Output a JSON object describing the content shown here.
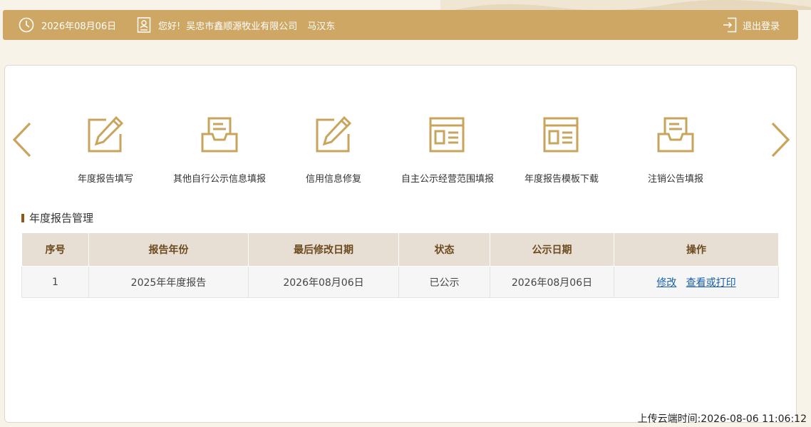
{
  "header": {
    "date": "2026年08月06日",
    "greeting": "您好!",
    "company": "吴忠市鑫顺源牧业有限公司",
    "user": "马汉东",
    "logout_label": "退出登录"
  },
  "functions": [
    {
      "label": "年度报告填写",
      "icon": "pencil-edit-icon"
    },
    {
      "label": "其他自行公示信息填报",
      "icon": "inbox-document-icon"
    },
    {
      "label": "信用信息修复",
      "icon": "pencil-edit-icon"
    },
    {
      "label": "自主公示经营范围填报",
      "icon": "web-page-icon"
    },
    {
      "label": "年度报告模板下载",
      "icon": "web-page-icon"
    },
    {
      "label": "注销公告填报",
      "icon": "inbox-document-icon"
    }
  ],
  "section": {
    "title": "年度报告管理"
  },
  "table": {
    "headers": [
      "序号",
      "报告年份",
      "最后修改日期",
      "状态",
      "公示日期",
      "操作"
    ],
    "rows": [
      {
        "index": "1",
        "year": "2025年年度报告",
        "modified": "2026年08月06日",
        "status": "已公示",
        "public_date": "2026年08月06日",
        "action_edit": "修改",
        "action_view": "查看或打印"
      }
    ]
  },
  "footer": {
    "upload_time": "上传云端时间:2026-08-06 11:06:12"
  },
  "colors": {
    "accent": "#cfa764",
    "icon": "#c9a45c",
    "header_text": "#6b4a1e",
    "link": "#1a5fa8"
  }
}
